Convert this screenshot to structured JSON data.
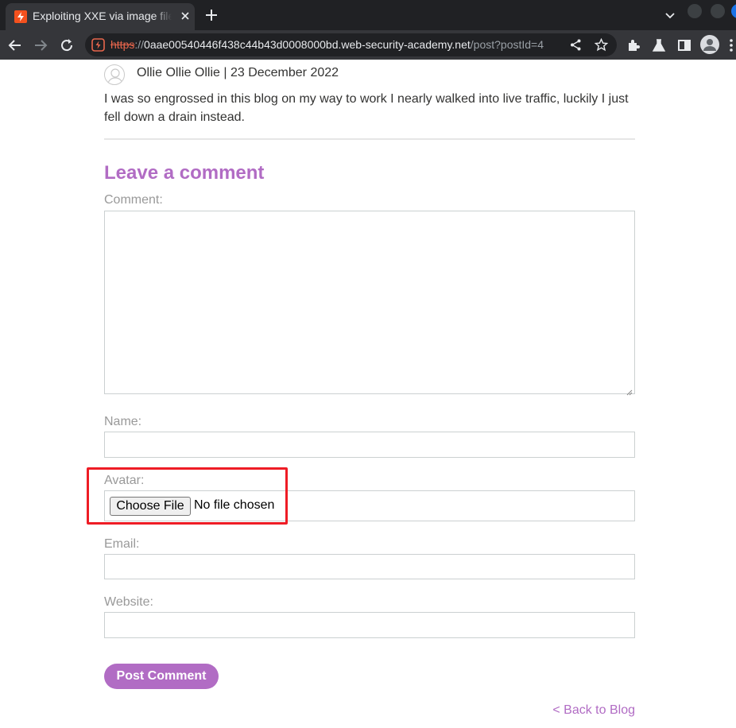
{
  "browser": {
    "tab_title": "Exploiting XXE via image file upload",
    "url_scheme": "https",
    "url_sep": "://",
    "url_host": "0aae00540446f438c44b43d0008000bd.web-security-academy.net",
    "url_path": "/post?postId=4"
  },
  "comment": {
    "author_line": "Ollie Ollie Ollie | 23 December 2022",
    "text": "I was so engrossed in this blog on my way to work I nearly walked into live traffic, luckily I just fell down a drain instead."
  },
  "form": {
    "heading": "Leave a comment",
    "comment_label": "Comment:",
    "name_label": "Name:",
    "avatar_label": "Avatar:",
    "choose_file_label": "Choose File",
    "no_file_text": "No file chosen",
    "email_label": "Email:",
    "website_label": "Website:",
    "submit_label": "Post Comment"
  },
  "footer": {
    "back_link": "< Back to Blog"
  },
  "colors": {
    "accent": "#b16cc4",
    "highlight": "#ee1c25",
    "label": "#999999"
  }
}
